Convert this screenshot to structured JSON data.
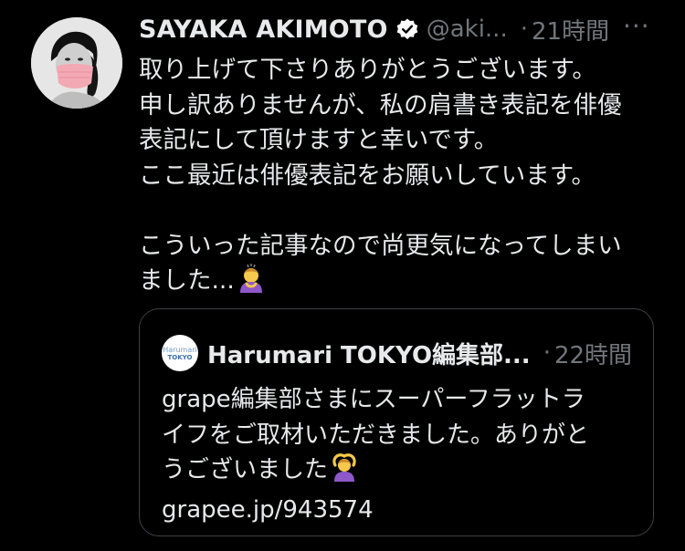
{
  "author": {
    "display_name": "SAYAKA AKIMOTO",
    "handle": "@aki...",
    "separator": "·",
    "time": "21時間",
    "more_label": "···",
    "verified_icon": "verified-badge-icon"
  },
  "tweet": {
    "lines": [
      "取り上げて下さりありがとうございます。",
      "申し訳ありませんが、私の肩書き表記を俳優",
      "表記にして頂けますと幸いです。",
      "ここ最近は俳優表記をお願いしています。",
      "",
      "こういった記事なので尚更気になってしまい",
      "ました..."
    ],
    "emoji_icon": "person-bowing-emoji-icon"
  },
  "quote": {
    "avatar_text_1": "Harumari",
    "avatar_text_2": "TOKYO",
    "display_name": "Harumari TOKYO編集部...",
    "separator": "·",
    "time": "22時間",
    "lines": [
      "grape編集部さまにスーパーフラットラ",
      "イフをご取材いただきました。ありがと",
      "うございました",
      "grapee.jp/943574"
    ],
    "emoji_icon": "person-gesturing-ok-emoji-icon"
  },
  "colors": {
    "background": "#000000",
    "text": "#e7e9ea",
    "muted": "#71767b",
    "border": "#3e4144",
    "emoji_purple": "#8e58c9",
    "emoji_skin": "#f4c247"
  }
}
